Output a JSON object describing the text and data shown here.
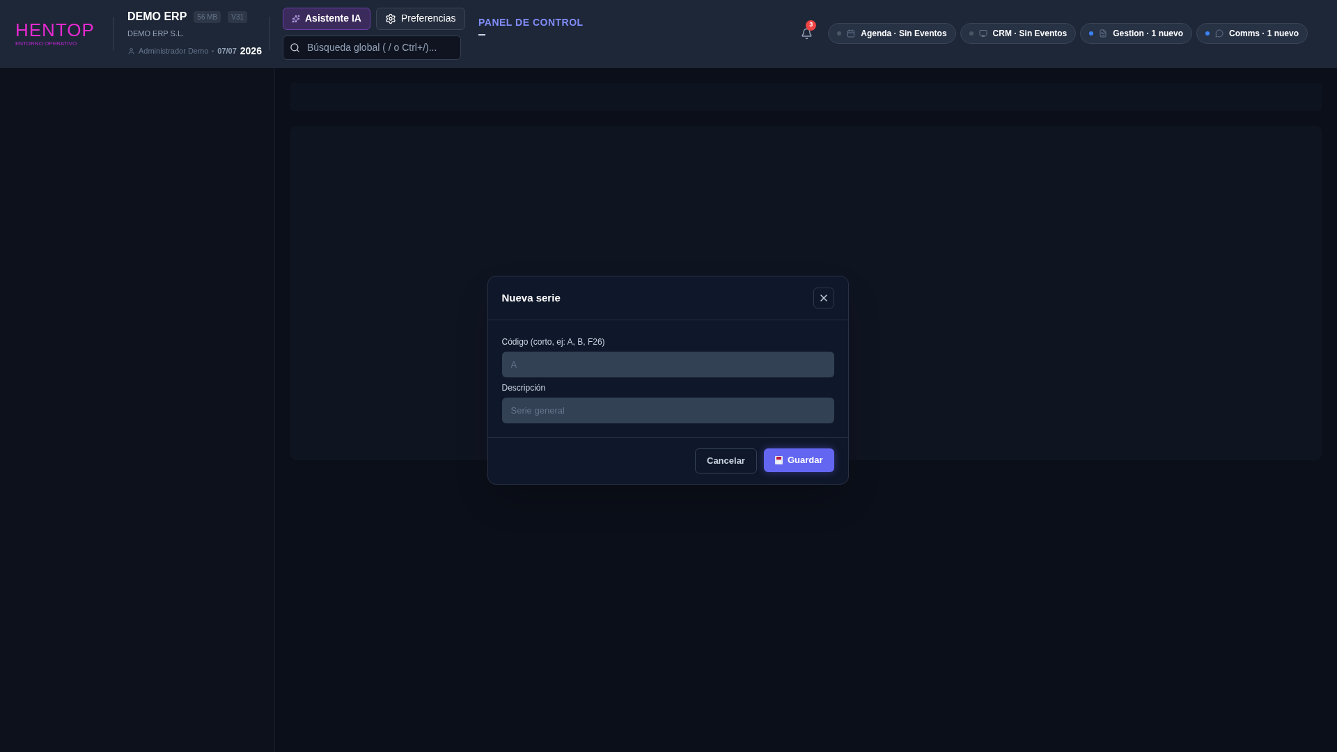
{
  "header": {
    "logo": {
      "name": "HENTOP",
      "tagline": "ENTORNO OPERATIVO"
    },
    "company": {
      "name": "DEMO ERP",
      "badges": [
        "56 MB",
        "V31"
      ],
      "legal_name": "DEMO ERP S.L.",
      "user": "Administrador Demo",
      "date": "07/07",
      "year": "2026"
    },
    "buttons": [
      {
        "label": "Asistente IA",
        "kind": "ai",
        "selected": true
      },
      {
        "label": "Preferencias",
        "kind": "settings",
        "selected": false
      }
    ],
    "search": {
      "placeholder": "Búsqueda global ( / o Ctrl+/)..."
    },
    "section_title": "PANEL DE CONTROL",
    "notifications": {
      "count": "3"
    },
    "status_chips": [
      {
        "label": "Agenda · Sin Eventos",
        "kind": "calendar",
        "color": "#4b5563"
      },
      {
        "label": "CRM · Sin Eventos",
        "kind": "crm",
        "color": "#4b5563"
      },
      {
        "label": "Gestion · 1 nuevo",
        "kind": "document",
        "color": "#3b82f6"
      },
      {
        "label": "Comms · 1 nuevo",
        "kind": "chat",
        "color": "#3b82f6"
      }
    ]
  },
  "dialog": {
    "title": "Nueva serie",
    "fields": [
      {
        "label": "Código (corto, ej: A, B, F26)",
        "placeholder": "A"
      },
      {
        "label": "Descripción",
        "placeholder": "Serie general"
      }
    ],
    "buttons": [
      {
        "label": "Cancelar",
        "kind": "secondary"
      },
      {
        "label": "Guardar",
        "kind": "primary"
      }
    ]
  }
}
